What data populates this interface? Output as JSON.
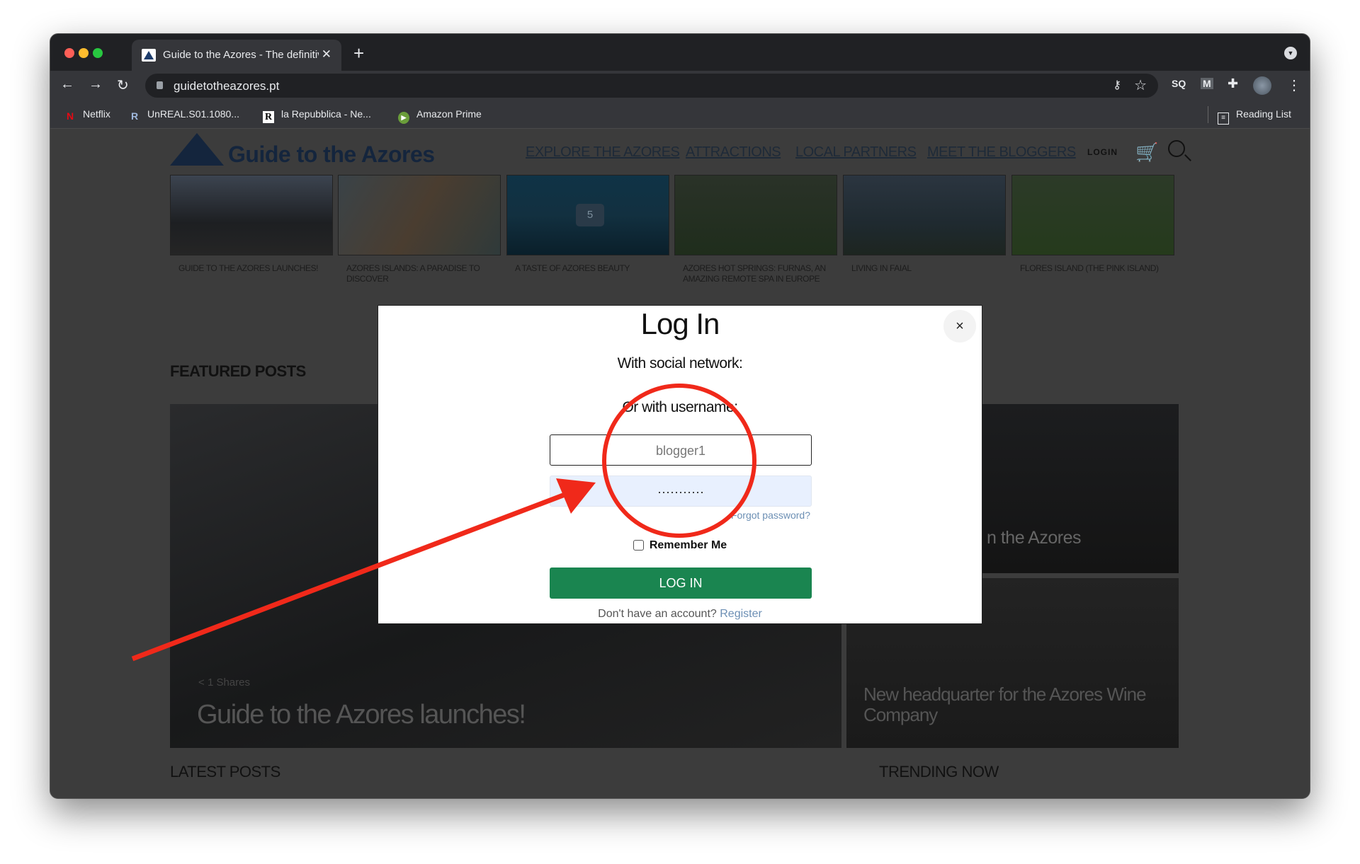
{
  "browser": {
    "tab_title": "Guide to the Azores - The definitive guide",
    "url": "guidetotheazores.pt",
    "bookmarks": [
      {
        "label": "Netflix",
        "icon": "netflix-icon"
      },
      {
        "label": "UnREAL.S01.1080...",
        "icon": "r-icon"
      },
      {
        "label": "la Repubblica - Ne...",
        "icon": "repubblica-icon"
      },
      {
        "label": "Amazon Prime",
        "icon": "play-icon"
      }
    ],
    "reading_list": "Reading List",
    "extensions": {
      "sq": "SQ",
      "m": "M"
    }
  },
  "site": {
    "logo_text": "Guide to the Azores",
    "nav": [
      "EXPLORE THE AZORES",
      "ATTRACTIONS",
      "LOCAL PARTNERS",
      "MEET THE BLOGGERS"
    ],
    "login": "LOGIN",
    "thumbnails": [
      {
        "caption": "GUIDE TO THE AZORES LAUNCHES!"
      },
      {
        "caption": "AZORES ISLANDS: A PARADISE TO DISCOVER"
      },
      {
        "caption": "A TASTE OF AZORES BEAUTY",
        "gallery_count": "5"
      },
      {
        "caption": "AZORES HOT SPRINGS: FURNAS, AN AMAZING REMOTE SPA IN EUROPE"
      },
      {
        "caption": "LIVING IN FAIAL"
      },
      {
        "caption": "FLORES ISLAND (THE PINK ISLAND)"
      }
    ],
    "featured_heading": "FEATURED POSTS",
    "featured": {
      "main_title": "Guide to the Azores launches!",
      "main_shares": "1 Shares",
      "side_top_title": "n the Azores",
      "side_bottom_title": "New headquarter for the Azores Wine Company"
    },
    "latest_heading": "LATEST POSTS",
    "trending_heading": "TRENDING NOW"
  },
  "modal": {
    "title": "Log In",
    "close": "×",
    "social_label": "With social network:",
    "username_label": "Or with username:",
    "username_value": "blogger1",
    "password_value": "···········",
    "forgot": "Forgot password?",
    "remember": "Remember Me",
    "submit": "LOG IN",
    "no_account": "Don't have an account?",
    "register": "Register",
    "button_color": "#1a8550"
  },
  "annotation_color": "#f0291a"
}
